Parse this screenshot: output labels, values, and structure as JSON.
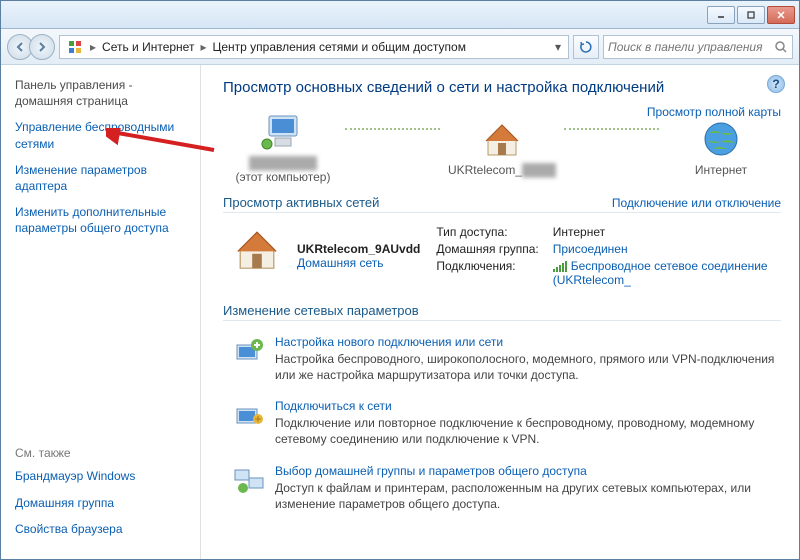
{
  "breadcrumb": {
    "seg1": "Сеть и Интернет",
    "seg2": "Центр управления сетями и общим доступом"
  },
  "search": {
    "placeholder": "Поиск в панели управления"
  },
  "sidebar": {
    "home": "Панель управления - домашняя страница",
    "wireless": "Управление беспроводными сетями",
    "adapter": "Изменение параметров адаптера",
    "sharing": "Изменить дополнительные параметры общего доступа",
    "see_also": "См. также",
    "firewall": "Брандмауэр Windows",
    "homegroup": "Домашняя группа",
    "browser": "Свойства браузера"
  },
  "main": {
    "title": "Просмотр основных сведений о сети и настройка подключений",
    "full_map": "Просмотр полной карты",
    "node_this_sub": "(этот компьютер)",
    "node_router": "UKRtelecom_",
    "node_internet": "Интернет",
    "sec_active": "Просмотр активных сетей",
    "sec_active_right": "Подключение или отключение",
    "net_name": "UKRtelecom_9AUvdd",
    "net_type": "Домашняя сеть",
    "prop_access_k": "Тип доступа:",
    "prop_access_v": "Интернет",
    "prop_hg_k": "Домашняя группа:",
    "prop_hg_v": "Присоединен",
    "prop_conn_k": "Подключения:",
    "prop_conn_v": "Беспроводное сетевое соединение (UKRtelecom_",
    "sec_change": "Изменение сетевых параметров",
    "task1_link": "Настройка нового подключения или сети",
    "task1_desc": "Настройка беспроводного, широкополосного, модемного, прямого или VPN-подключения или же настройка маршрутизатора или точки доступа.",
    "task2_link": "Подключиться к сети",
    "task2_desc": "Подключение или повторное подключение к беспроводному, проводному, модемному сетевому соединению или подключение к VPN.",
    "task3_link": "Выбор домашней группы и параметров общего доступа",
    "task3_desc": "Доступ к файлам и принтерам, расположенным на других сетевых компьютерах, или изменение параметров общего доступа."
  }
}
